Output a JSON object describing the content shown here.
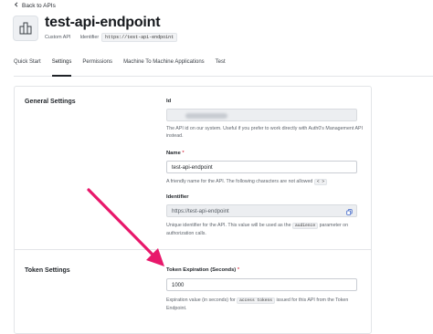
{
  "nav": {
    "back_label": "Back to APIs"
  },
  "header": {
    "title": "test-api-endpoint",
    "api_type": "Custom API",
    "identifier_label": "Identifier",
    "identifier_value": "https://test-api-endpoint"
  },
  "tabs": [
    {
      "label": "Quick Start",
      "active": false
    },
    {
      "label": "Settings",
      "active": true
    },
    {
      "label": "Permissions",
      "active": false
    },
    {
      "label": "Machine To Machine Applications",
      "active": false
    },
    {
      "label": "Test",
      "active": false
    }
  ],
  "general_settings": {
    "title": "General Settings",
    "id_field": {
      "label": "Id",
      "help": "The API id on our system. Useful if you prefer to work directly with Auth0's Management API instead."
    },
    "name_field": {
      "label": "Name",
      "required_mark": "*",
      "value": "test-api-endpoint",
      "help": "A friendly name for the API. The following characters are not allowed",
      "help_chip": "< >"
    },
    "identifier_field": {
      "label": "Identifier",
      "value": "https://test-api-endpoint",
      "help_before": "Unique identifier for the API. This value will be used as the",
      "help_chip": "audience",
      "help_after": "parameter on authorization calls."
    }
  },
  "token_settings": {
    "title": "Token Settings",
    "expiration_field": {
      "label": "Token Expiration (Seconds)",
      "required_mark": "*",
      "value": "1000",
      "help_before": "Expiration value (in seconds) for",
      "help_chip": "access tokens",
      "help_after": "issued for this API from the Token Endpoint."
    }
  },
  "colors": {
    "annotation_arrow": "#e8186b",
    "text_primary": "#1f2328",
    "border": "#e3e5e8"
  },
  "icons": {
    "back": "chevron-left-icon",
    "api": "building-blocks-icon",
    "copy": "copy-icon"
  }
}
